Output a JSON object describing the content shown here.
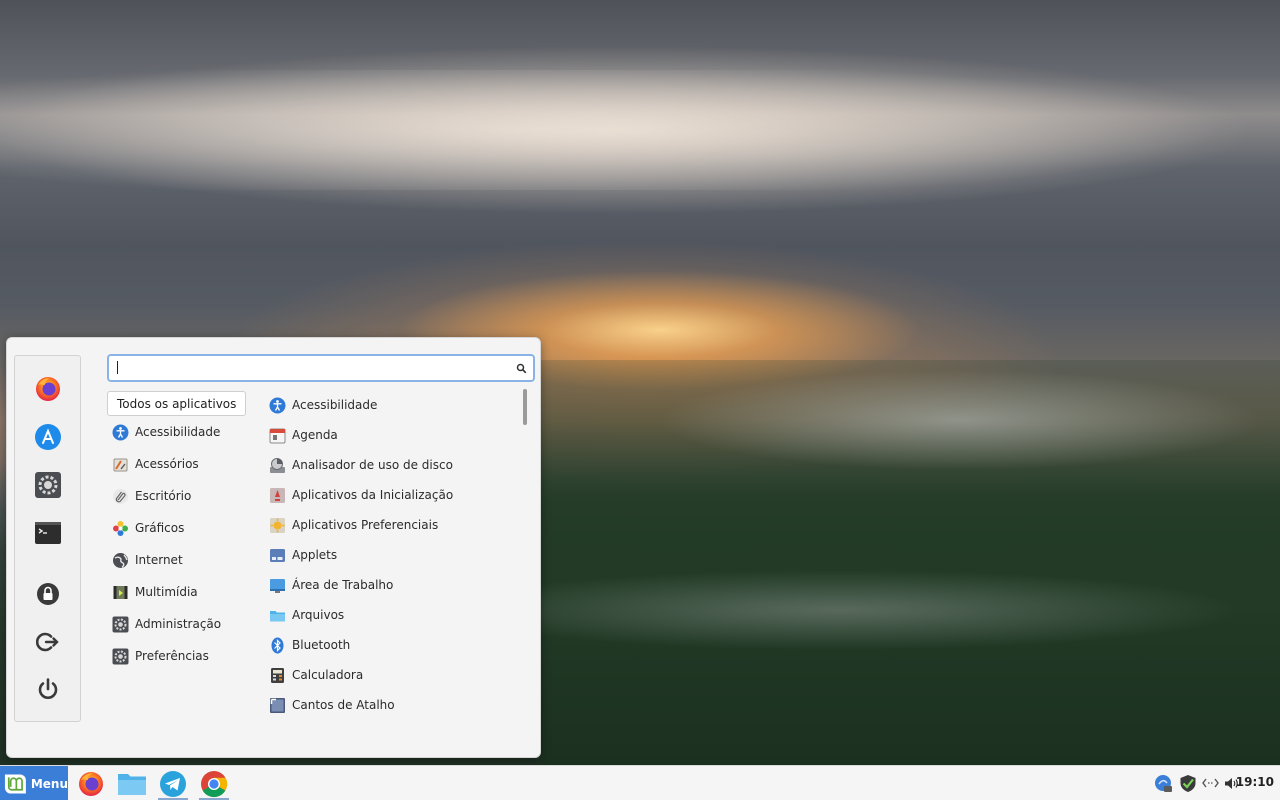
{
  "desktop": {
    "wallpaper": "sunset-over-misty-forest"
  },
  "menu": {
    "favorites": [
      {
        "name": "Firefox",
        "icon": "firefox-icon"
      },
      {
        "name": "Software Manager",
        "icon": "software-manager-icon"
      },
      {
        "name": "System Settings",
        "icon": "settings-icon"
      },
      {
        "name": "Terminal",
        "icon": "terminal-icon"
      }
    ],
    "session": [
      {
        "name": "Lock Screen",
        "icon": "lock-icon"
      },
      {
        "name": "Logout",
        "icon": "logout-icon"
      },
      {
        "name": "Quit",
        "icon": "power-icon"
      }
    ],
    "search": {
      "value": "",
      "placeholder": ""
    },
    "categories": {
      "all_label": "Todos os aplicativos",
      "items": [
        {
          "label": "Acessibilidade",
          "icon": "accessibility-icon"
        },
        {
          "label": "Acessórios",
          "icon": "accessories-icon"
        },
        {
          "label": "Escritório",
          "icon": "office-icon"
        },
        {
          "label": "Gráficos",
          "icon": "graphics-icon"
        },
        {
          "label": "Internet",
          "icon": "internet-icon"
        },
        {
          "label": "Multimídia",
          "icon": "multimedia-icon"
        },
        {
          "label": "Administração",
          "icon": "administration-icon"
        },
        {
          "label": "Preferências",
          "icon": "preferences-icon"
        }
      ]
    },
    "apps": [
      {
        "label": "Acessibilidade",
        "icon": "accessibility-icon"
      },
      {
        "label": "Agenda",
        "icon": "calendar-icon"
      },
      {
        "label": "Analisador de uso de disco",
        "icon": "disk-usage-icon"
      },
      {
        "label": "Aplicativos da Inicialização",
        "icon": "startup-apps-icon"
      },
      {
        "label": "Aplicativos Preferenciais",
        "icon": "preferred-apps-icon"
      },
      {
        "label": "Applets",
        "icon": "applets-icon"
      },
      {
        "label": "Área de Trabalho",
        "icon": "desktop-icon"
      },
      {
        "label": "Arquivos",
        "icon": "folder-icon"
      },
      {
        "label": "Bluetooth",
        "icon": "bluetooth-icon"
      },
      {
        "label": "Calculadora",
        "icon": "calculator-icon"
      },
      {
        "label": "Cantos de Atalho",
        "icon": "hot-corners-icon"
      }
    ]
  },
  "taskbar": {
    "menu_label": "Menu",
    "launchers": [
      {
        "name": "Firefox",
        "icon": "firefox-icon"
      },
      {
        "name": "Files",
        "icon": "folder-icon"
      },
      {
        "name": "Telegram",
        "icon": "telegram-icon"
      },
      {
        "name": "Chrome",
        "icon": "chrome-icon"
      }
    ],
    "tray": [
      {
        "name": "Update Manager",
        "icon": "update-manager-icon"
      },
      {
        "name": "Shield",
        "icon": "shield-check-icon"
      },
      {
        "name": "Network",
        "icon": "network-icon"
      },
      {
        "name": "Volume",
        "icon": "volume-icon"
      }
    ],
    "clock": "19:10"
  },
  "colors": {
    "accent": "#3b7ed8",
    "search_border": "#8ab4e8",
    "panel_bg": "#f4f4f4",
    "taskbar_bg": "#f5f5f5"
  }
}
